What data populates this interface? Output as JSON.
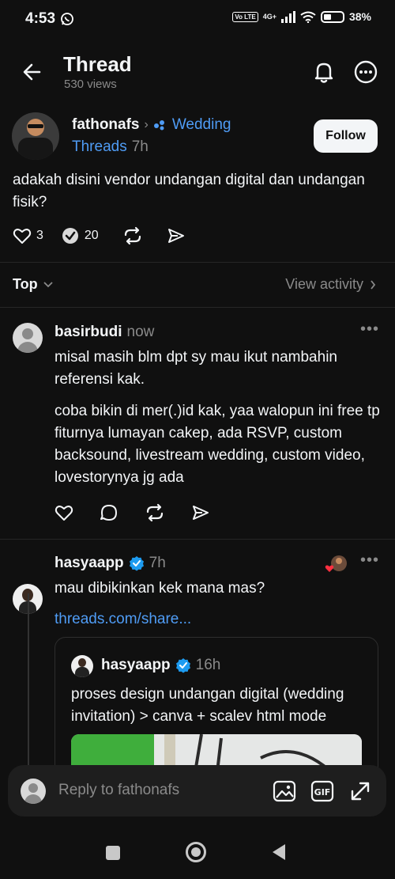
{
  "status_bar": {
    "time": "4:53",
    "network": "4G+",
    "volte": "Vo LTE",
    "battery": "38%"
  },
  "header": {
    "title": "Thread",
    "views": "530 views"
  },
  "post": {
    "author": "fathonafs",
    "topic": "Wedding",
    "topic_line2": "Threads",
    "time": "7h",
    "follow_label": "Follow",
    "text": "adakah disini vendor undangan digital dan undangan fisik?",
    "likes": "3",
    "replies": "20"
  },
  "sort": {
    "label": "Top",
    "view_activity": "View activity"
  },
  "comments": [
    {
      "author": "basirbudi",
      "time": "now",
      "text1": "misal masih blm dpt sy mau ikut nambahin referensi kak.",
      "text2": "coba bikin di mer(.)id kak, yaa walopun ini free tp fiturnya lumayan cakep, ada RSVP, custom backsound, livestream wedding, custom video, lovestorynya jg ada"
    },
    {
      "author": "hasyaapp",
      "time": "7h",
      "text": "mau dibikinkan kek mana mas?",
      "link": "threads.com/share...",
      "quote": {
        "author": "hasyaapp",
        "time": "16h",
        "text": "proses design undangan digital (wedding invitation) > canva + scalev html mode"
      }
    }
  ],
  "reply_bar": {
    "placeholder": "Reply to fathonafs"
  },
  "colors": {
    "background": "#101010",
    "link": "#4f9cf5",
    "verified": "#1d9bf0",
    "muted": "#8a8a8a"
  }
}
